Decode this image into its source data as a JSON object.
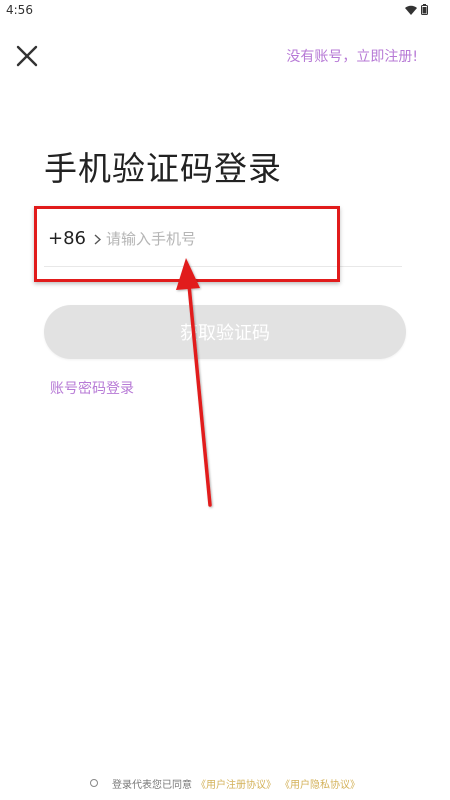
{
  "status_bar": {
    "time": "4:56"
  },
  "top_bar": {
    "register_link": "没有账号，立即注册!"
  },
  "title": "手机验证码登录",
  "phone": {
    "country_code": "+86",
    "placeholder": "请输入手机号"
  },
  "get_code_button": "获取验证码",
  "password_login_link": "账号密码登录",
  "agreement": {
    "prefix": "登录代表您已同意",
    "user_agreement": "《用户注册协议》",
    "privacy_agreement": "《用户隐私协议》"
  },
  "colors": {
    "accent": "#b77ad6",
    "link_gold": "#d4b25a",
    "annotation_red": "#e11b1b",
    "button_disabled": "#e2e2e2"
  }
}
